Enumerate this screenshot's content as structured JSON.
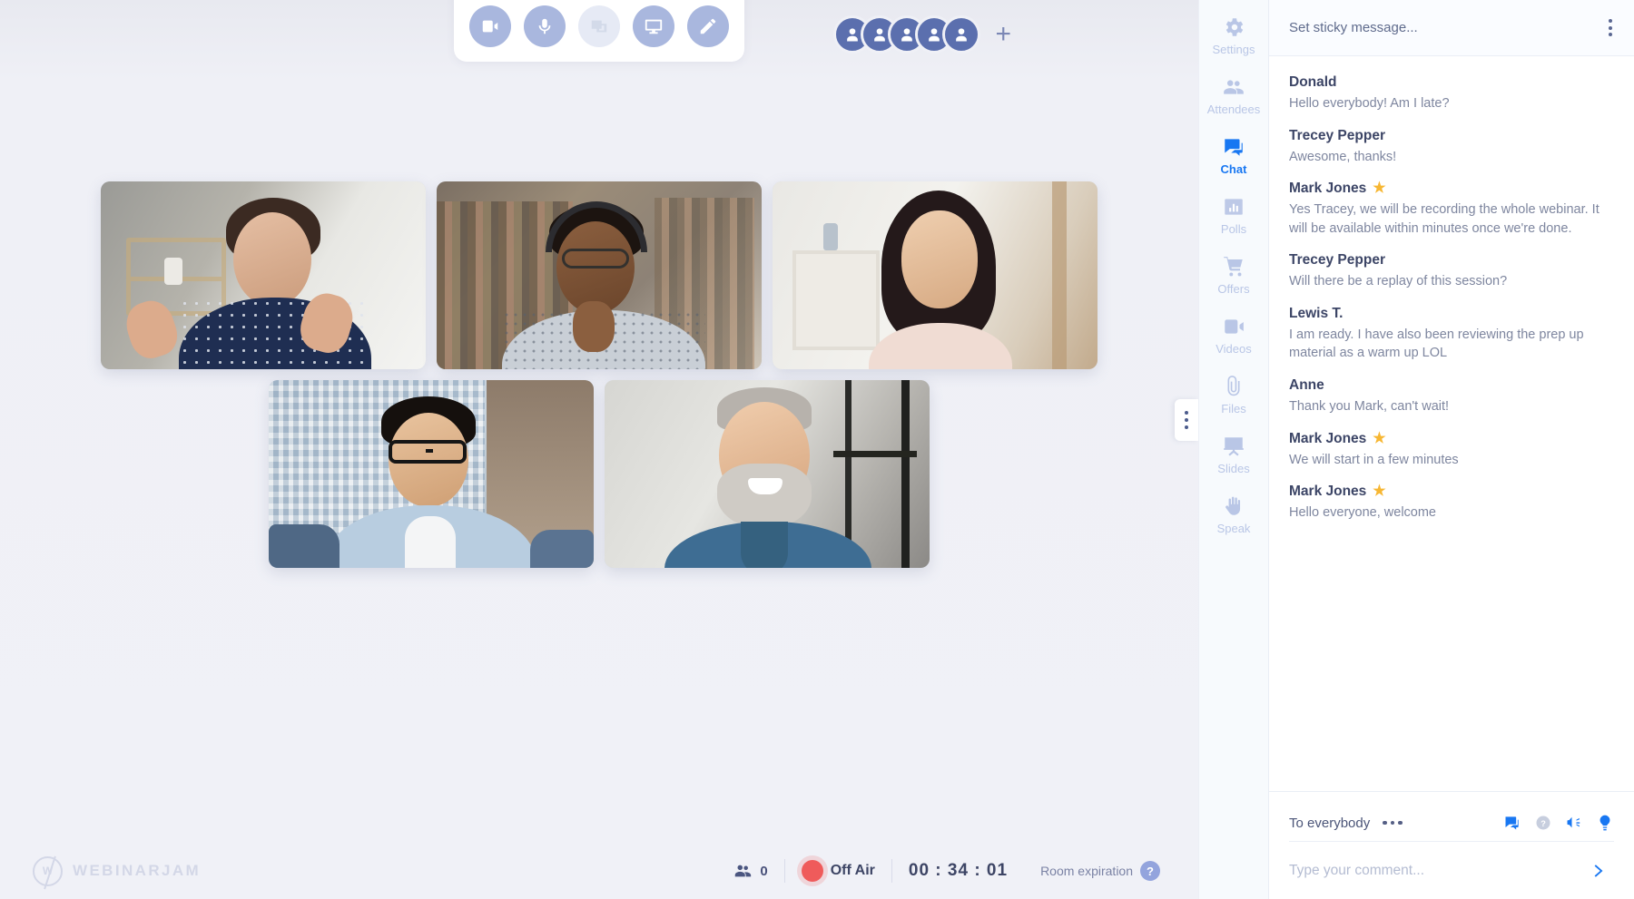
{
  "toolbar": {
    "buttons": [
      {
        "name": "camera-button",
        "icon": "video-camera-icon",
        "state": "on"
      },
      {
        "name": "microphone-button",
        "icon": "microphone-icon",
        "state": "on"
      },
      {
        "name": "screenshare-button",
        "icon": "screenshare-icon",
        "state": "off"
      },
      {
        "name": "presentation-button",
        "icon": "monitor-icon",
        "state": "on"
      },
      {
        "name": "whiteboard-button",
        "icon": "pencil-icon",
        "state": "on"
      }
    ]
  },
  "attendees_bar": {
    "avatar_count": 5,
    "add_label": "+"
  },
  "videos": [
    {
      "id": "tile-1",
      "participant": "presenter-1"
    },
    {
      "id": "tile-2",
      "participant": "presenter-2"
    },
    {
      "id": "tile-3",
      "participant": "presenter-3"
    },
    {
      "id": "tile-4",
      "participant": "presenter-4"
    },
    {
      "id": "tile-5",
      "participant": "presenter-5"
    }
  ],
  "statusbar": {
    "brand_mark": "W",
    "brand_text": "WEBINARJAM",
    "attendee_count": "0",
    "broadcast_status": "Off Air",
    "timer": "00 : 34 : 01",
    "room_expiration_label": "Room expiration",
    "help_label": "?"
  },
  "sidebar": {
    "items": [
      {
        "label": "Settings",
        "icon": "gear-icon",
        "active": false
      },
      {
        "label": "Attendees",
        "icon": "people-icon",
        "active": false
      },
      {
        "label": "Chat",
        "icon": "chat-bubble-icon",
        "active": true
      },
      {
        "label": "Polls",
        "icon": "bar-chart-icon",
        "active": false
      },
      {
        "label": "Offers",
        "icon": "shopping-cart-icon",
        "active": false
      },
      {
        "label": "Videos",
        "icon": "video-camera-icon",
        "active": false
      },
      {
        "label": "Files",
        "icon": "paperclip-icon",
        "active": false
      },
      {
        "label": "Slides",
        "icon": "presentation-icon",
        "active": false
      },
      {
        "label": "Speak",
        "icon": "raised-hand-icon",
        "active": false
      }
    ]
  },
  "chat": {
    "sticky_placeholder": "Set sticky message...",
    "messages": [
      {
        "author": "Donald",
        "host": false,
        "text": "Hello everybody! Am I late?"
      },
      {
        "author": "Trecey Pepper",
        "host": false,
        "text": "Awesome, thanks!"
      },
      {
        "author": "Mark Jones",
        "host": true,
        "text": "Yes Tracey, we will be recording the whole webinar. It will be available within minutes once we're done."
      },
      {
        "author": "Trecey Pepper",
        "host": false,
        "text": "Will there be a replay of this session?"
      },
      {
        "author": "Lewis T.",
        "host": false,
        "text": "I am ready. I have also been reviewing the prep up material as a warm up LOL"
      },
      {
        "author": "Anne",
        "host": false,
        "text": "Thank you Mark, can't wait!"
      },
      {
        "author": "Mark Jones",
        "host": true,
        "text": "We will start in a few minutes"
      },
      {
        "author": "Mark Jones",
        "host": true,
        "text": "Hello everyone, welcome"
      }
    ],
    "footer": {
      "recipient": "To everybody",
      "icons": [
        {
          "name": "chat-icon",
          "active": true
        },
        {
          "name": "question-icon",
          "active": false
        },
        {
          "name": "megaphone-icon",
          "active": true
        },
        {
          "name": "lightbulb-icon",
          "active": true
        }
      ]
    },
    "composer": {
      "value": "",
      "placeholder": "Type your comment...",
      "send_label": "send-arrow-icon"
    }
  },
  "colors": {
    "accent": "#1877f2",
    "stage_bg": "#f0f1f7",
    "rail_bg": "#f7fafd",
    "panel_bg": "#ffffff",
    "host_star": "#f7b733",
    "offair_red": "#ef5b5b",
    "toolbar_btn": "#a9b7de",
    "avatar": "#5b6fae"
  }
}
